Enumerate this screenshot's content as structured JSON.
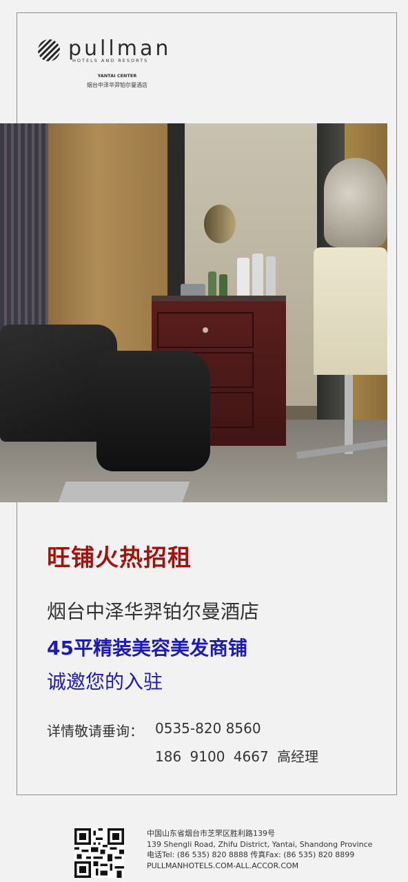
{
  "logo": {
    "brand": "pullman",
    "tagline": "HOTELS AND RESORTS",
    "location": "YANTAI CENTER",
    "hotel_cn": "烟台中泽华羿铂尔曼酒店"
  },
  "photo": {
    "icon": "salon-photo"
  },
  "promo": {
    "headline": "旺铺火热招租",
    "hotel": "烟台中泽华羿铂尔曼酒店",
    "offer": "45平精装美容美发商铺",
    "invite": "诚邀您的入驻"
  },
  "contact": {
    "label": "详情敬请垂询：",
    "phone_1": "0535-820 8560",
    "phone_2": "186  9100  4667  高经理"
  },
  "footer": {
    "address_cn": "中国山东省烟台市芝罘区胜利路139号",
    "address_en": "139 Shengli Road, Zhifu District, Yantai, Shandong Province",
    "tel_fax": "电话Tel: (86 535) 820 8888  传真Fax: (86 535) 820 8899",
    "website": "PULLMANHOTELS.COM-ALL.ACCOR.COM",
    "qr_icon": "qr-code-icon"
  },
  "colors": {
    "headline": "#a0140e",
    "accent_blue": "#1d1ab8",
    "text": "#333333"
  }
}
